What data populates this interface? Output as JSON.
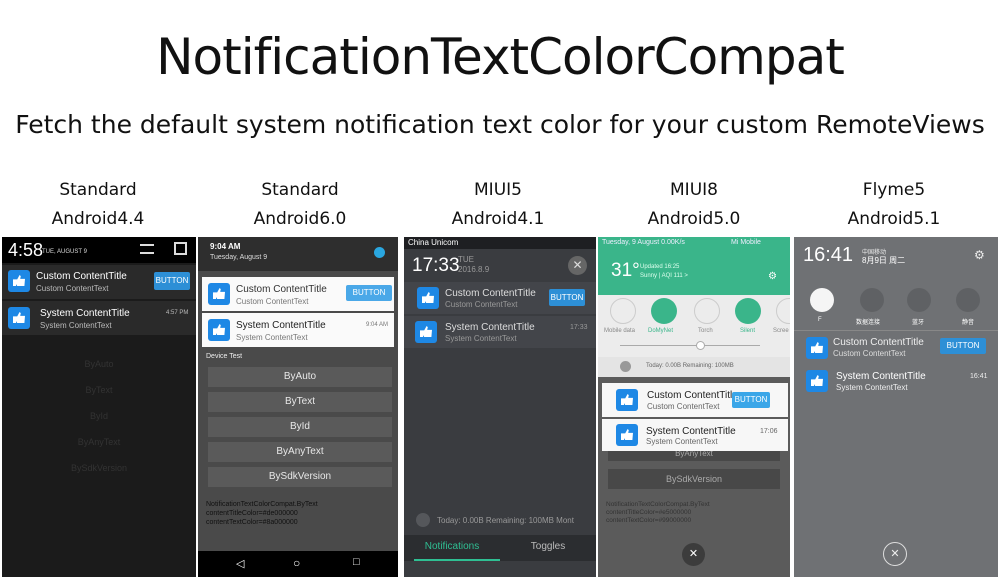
{
  "header": {
    "title": "NotificationTextColorCompat",
    "subtitle": "Fetch the default system notification text color for your custom RemoteViews"
  },
  "columns": [
    {
      "line1": "Standard",
      "line2": "Android4.4"
    },
    {
      "line1": "Standard",
      "line2": "Android6.0"
    },
    {
      "line1": "MIUI5",
      "line2": "Android4.1"
    },
    {
      "line1": "MIUI8",
      "line2": "Android5.0"
    },
    {
      "line1": "Flyme5",
      "line2": "Android5.1"
    }
  ],
  "s1": {
    "time": "4:58",
    "date": "TUE, AUGUST 9",
    "custom_title": "Custom ContentTitle",
    "custom_text": "Custom ContentText",
    "button": "BUTTON",
    "system_title": "System ContentTitle",
    "system_text": "System ContentText",
    "system_time": "4:57 PM",
    "faded": [
      "ByAuto",
      "ByText",
      "ById",
      "ByAnyText",
      "BySdkVersion"
    ]
  },
  "s2": {
    "time": "9:04 AM",
    "date": "Tuesday, August 9",
    "custom_title": "Custom ContentTitle",
    "custom_text": "Custom ContentText",
    "button": "BUTTON",
    "system_title": "System ContentTitle",
    "system_text": "System ContentText",
    "system_time": "9:04 AM",
    "device_test": "Device Test",
    "buttons": [
      "ByAuto",
      "ByText",
      "ById",
      "ByAnyText",
      "BySdkVersion"
    ],
    "info1": "NotificationTextColorCompat.ByText",
    "info2": "contentTitleColor=#de000000",
    "info3": "contentTextColor=#8a000000"
  },
  "s3": {
    "carrier": "China Unicom",
    "time": "17:33",
    "day": "TUE",
    "date": "2016.8.9",
    "custom_title": "Custom ContentTitle",
    "custom_text": "Custom ContentText",
    "button": "BUTTON",
    "system_title": "System ContentTitle",
    "system_text": "System ContentText",
    "system_time": "17:33",
    "storage": "Today: 0.00B  Remaining: 100MB  Mont",
    "tab_notifications": "Notifications",
    "tab_toggles": "Toggles"
  },
  "s4": {
    "status": "Tuesday, 9  August 0.00K/s",
    "carrier": "Mi Mobile",
    "temp": "31°",
    "updated": "Updated 16:25",
    "weather": "Sunny | AQI 111 >",
    "toggles": [
      "Mobile data",
      "DoMyNet",
      "Torch",
      "Silent",
      "Scree"
    ],
    "storage": "Today: 0.00B   Remaining: 100MB",
    "custom_title": "Custom ContentTitle",
    "custom_text": "Custom ContentText",
    "button": "BUTTON",
    "system_title": "System ContentTitle",
    "system_text": "System ContentText",
    "system_time": "17:06",
    "bg1": "ByAnyText",
    "bg2": "BySdkVersion",
    "info1": "NotificationTextColorCompat.ByText",
    "info2": "contentTitleColor=#e5000000",
    "info3": "contentTextColor=#99000000"
  },
  "s5": {
    "time": "16:41",
    "carrier": "中国移动",
    "date": "8月9日 周二",
    "toggles": [
      "F",
      "数据连接",
      "蓝牙",
      "静音"
    ],
    "custom_title": "Custom ContentTitle",
    "custom_text": "Custom ContentText",
    "button": "BUTTON",
    "system_title": "System ContentTitle",
    "system_text": "System ContentText",
    "system_time": "16:41"
  },
  "colors": {
    "accent_blue": "#2d8fd6",
    "miui8_green": "#3ab58a",
    "miui5_tab": "#2fbf93"
  }
}
